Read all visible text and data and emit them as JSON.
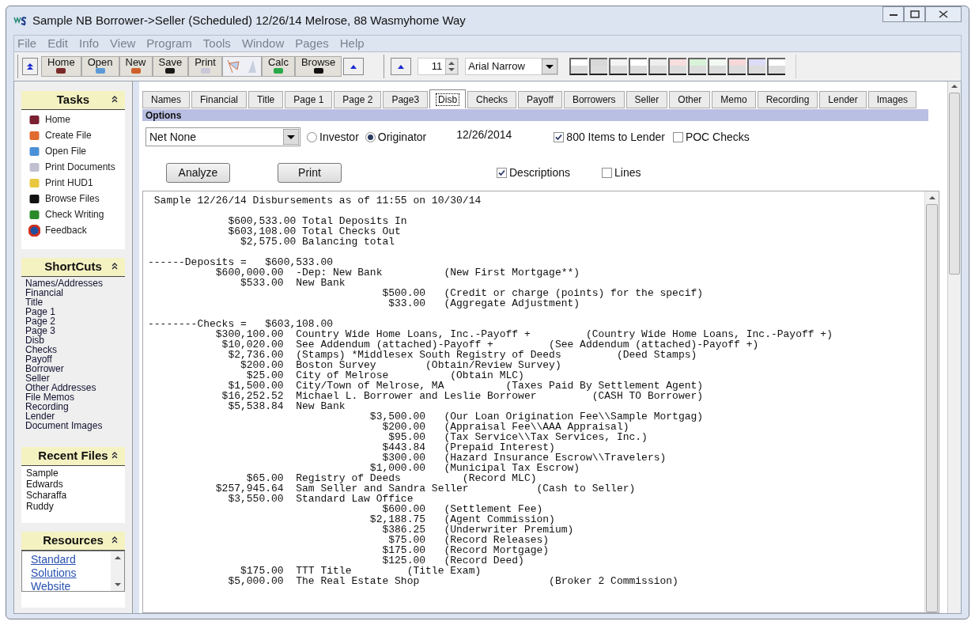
{
  "window": {
    "title": "Sample NB Borrower->Seller (Scheduled) 12/26/14 Melrose, 88 Wasmyhome Way"
  },
  "menu": [
    "File",
    "Edit",
    "Info",
    "View",
    "Program",
    "Tools",
    "Window",
    "Pages",
    "Help"
  ],
  "toolbar": {
    "buttons": [
      {
        "kind": "text",
        "label": "Home"
      },
      {
        "kind": "text",
        "label": "Open"
      },
      {
        "kind": "text",
        "label": "New"
      },
      {
        "kind": "text",
        "label": "Save"
      },
      {
        "kind": "text",
        "label": "Print"
      },
      {
        "kind": "picture"
      },
      {
        "kind": "text",
        "label": "Calc"
      },
      {
        "kind": "text",
        "label": "Browse"
      }
    ],
    "font_size": "11",
    "font": "Arial Narrow",
    "swatches": [
      {
        "color": "#ffffff"
      },
      {
        "color": "#d8d8d8"
      },
      {
        "color": "#f4f4f4"
      },
      {
        "color": "#ffffff"
      },
      {
        "color": "#eeeeee"
      },
      {
        "color": "#f8dede"
      },
      {
        "color": "#d8f2d8"
      },
      {
        "color": "#f2f8f2"
      },
      {
        "color": "#f6d8d8"
      },
      {
        "color": "#dcdcf6"
      },
      {
        "color": "#ffffff"
      }
    ]
  },
  "sidebar": {
    "tasks": {
      "title": "Tasks",
      "items": [
        "Home",
        "Create File",
        "Open File",
        "Print Documents",
        "Print HUD1",
        "Browse Files",
        "Check Writing",
        "Feedback"
      ]
    },
    "shortcuts": {
      "title": "ShortCuts",
      "items": [
        "Names/Addresses",
        "Financial",
        "Title",
        "Page 1",
        "Page 2",
        "Page 3",
        "Disb",
        "Checks",
        "Payoff",
        "Borrower",
        "Seller",
        "Other Addresses",
        "File Memos",
        "Recording",
        "Lender",
        "Document Images"
      ]
    },
    "recent": {
      "title": "Recent Files",
      "items": [
        "Sample",
        "Edwards",
        "Scharaffa",
        "Ruddy"
      ]
    },
    "resources": {
      "title": "Resources",
      "links": [
        "Standard",
        "Solutions",
        "Website"
      ]
    }
  },
  "tabs": [
    {
      "label": "Names",
      "selected": false
    },
    {
      "label": "Financial",
      "selected": false
    },
    {
      "label": "Title",
      "selected": false
    },
    {
      "label": "Page 1",
      "selected": false
    },
    {
      "label": "Page 2",
      "selected": false
    },
    {
      "label": "Page3",
      "selected": false
    },
    {
      "label": "Disb",
      "selected": true
    },
    {
      "label": "Checks",
      "selected": false
    },
    {
      "label": "Payoff",
      "selected": false
    },
    {
      "label": "Borrowers",
      "selected": false
    },
    {
      "label": "Seller",
      "selected": false
    },
    {
      "label": "Other",
      "selected": false
    },
    {
      "label": "Memo",
      "selected": false
    },
    {
      "label": "Recording",
      "selected": false
    },
    {
      "label": "Lender",
      "selected": false
    },
    {
      "label": "Images",
      "selected": false
    }
  ],
  "options": {
    "title": "Options",
    "dropdown": "Net None",
    "radios": [
      {
        "label": "Investor",
        "selected": false
      },
      {
        "label": "Originator",
        "selected": true
      }
    ],
    "date": "12/26/2014",
    "checks_top": [
      {
        "label": "800 Items to Lender",
        "checked": true
      },
      {
        "label": "POC Checks",
        "checked": false
      }
    ],
    "buttons": [
      "Analyze",
      "Print"
    ],
    "checks_bottom": [
      {
        "label": "Descriptions",
        "checked": true
      },
      {
        "label": "Lines",
        "checked": false
      }
    ]
  },
  "report": {
    "blocks": [
      [
        " Sample 12/26/14 Disbursements as of 11:55 on 10/30/14"
      ],
      [
        "             $600,533.00 Total Deposits In",
        "             $603,108.00 Total Checks Out",
        "               $2,575.00 Balancing total"
      ],
      [
        "------Deposits =   $600,533.00",
        "           $600,000.00  -Dep: New Bank          (New First Mortgage**)",
        "               $533.00  New Bank",
        "                                      $500.00   (Credit or charge (points) for the specif)",
        "                                       $33.00   (Aggregate Adjustment)"
      ],
      [
        "--------Checks =   $603,108.00",
        "           $300,100.00  Country Wide Home Loans, Inc.-Payoff +         (Country Wide Home Loans, Inc.-Payoff +)",
        "            $10,020.00  See Addendum (attached)-Payoff +         (See Addendum (attached)-Payoff +)",
        "             $2,736.00  (Stamps) *Middlesex South Registry of Deeds         (Deed Stamps)",
        "               $200.00  Boston Survey        (Obtain/Review Survey)",
        "                $25.00  City of Melrose          (Obtain MLC)",
        "             $1,500.00  City/Town of Melrose, MA          (Taxes Paid By Settlement Agent)",
        "            $16,252.52  Michael L. Borrower and Leslie Borrower         (CASH TO Borrower)",
        "             $5,538.84  New Bank",
        "                                    $3,500.00   (Our Loan Origination Fee\\\\Sample Mortgag)",
        "                                      $200.00   (Appraisal Fee\\\\AAA Appraisal)",
        "                                       $95.00   (Tax Service\\\\Tax Services, Inc.)",
        "                                      $443.84   (Prepaid Interest)",
        "                                      $300.00   (Hazard Insurance Escrow\\\\Travelers)",
        "                                    $1,000.00   (Municipal Tax Escrow)",
        "                $65.00  Registry of Deeds          (Record MLC)",
        "           $257,945.64  Sam Seller and Sandra Seller           (Cash to Seller)",
        "             $3,550.00  Standard Law Office",
        "                                      $600.00   (Settlement Fee)",
        "                                    $2,188.75   (Agent Commission)",
        "                                      $386.25   (Underwriter Premium)",
        "                                       $75.00   (Record Releases)",
        "                                      $175.00   (Record Mortgage)",
        "                                      $125.00   (Record Deed)",
        "               $175.00  TTT Title         (Title Exam)",
        "             $5,000.00  The Real Estate Shop                     (Broker 2 Commission)"
      ]
    ]
  }
}
